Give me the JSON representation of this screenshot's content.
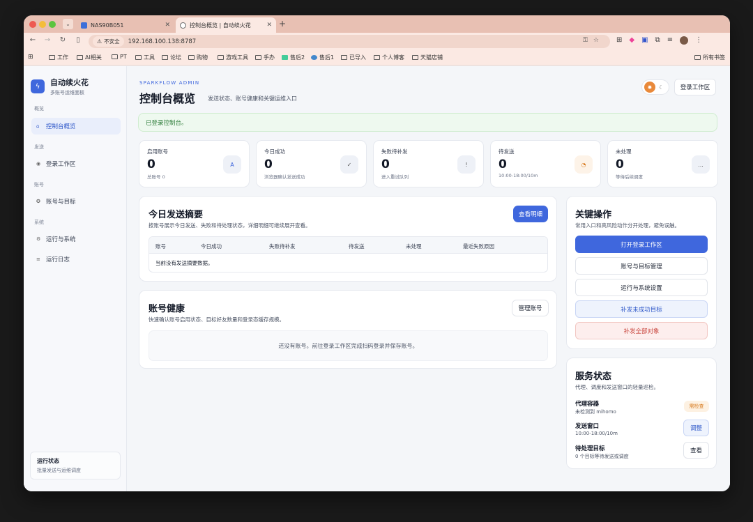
{
  "browser": {
    "tabs": [
      {
        "title": "NAS90B051"
      },
      {
        "title": "控制台概览 | 自动续火花"
      }
    ],
    "address": {
      "security_label": "不安全",
      "url": "192.168.100.138:8787"
    },
    "bookmarks": [
      "工作",
      "AI相关",
      "PT",
      "工具",
      "论坛",
      "购物",
      "游戏工具",
      "手办",
      "售后2",
      "售后1",
      "已导入",
      "个人博客",
      "天猫店铺"
    ],
    "all_bookmarks": "所有书签"
  },
  "sidebar": {
    "brand": {
      "name": "自动续火花",
      "subtitle": "多账号运维面板",
      "icon": "lightning-icon"
    },
    "sections": {
      "overview": "概览",
      "send": "发送",
      "account": "账号",
      "system": "系统"
    },
    "items": [
      {
        "label": "控制台概览",
        "icon": "home-icon"
      },
      {
        "label": "登录工作区",
        "icon": "target-icon"
      },
      {
        "label": "账号与目标",
        "icon": "gear-icon"
      },
      {
        "label": "运行与系统",
        "icon": "settings-icon"
      },
      {
        "label": "运行日志",
        "icon": "list-icon"
      }
    ],
    "status_box": {
      "title": "运行状态",
      "subtitle": "批量发送与运维调度"
    }
  },
  "header": {
    "eyebrow": "SPARKFLOW ADMIN",
    "title": "控制台概览",
    "subtitle": "发送状态、账号健康和关键运维入口",
    "login_button": "登录工作区"
  },
  "alert": "已登录控制台。",
  "stats": [
    {
      "label": "启用账号",
      "value": "0",
      "note": "总账号 0",
      "icon": "A"
    },
    {
      "label": "今日成功",
      "value": "0",
      "note": "浏览器确认发送成功",
      "icon": "✓"
    },
    {
      "label": "失败待补发",
      "value": "0",
      "note": "进入重试队列",
      "icon": "!"
    },
    {
      "label": "待发送",
      "value": "0",
      "note": "10:00-18:00/10m",
      "icon": "◔"
    },
    {
      "label": "未处理",
      "value": "0",
      "note": "等待后续调度",
      "icon": "..."
    }
  ],
  "summary": {
    "title": "今日发送摘要",
    "desc": "按账号展示今日发送、失败和待处理状态，详细明细可继续展开查看。",
    "button": "查看明细",
    "columns": [
      "账号",
      "今日成功",
      "失败待补发",
      "待发送",
      "未处理",
      "最近失败原因"
    ],
    "empty": "当前没有发送摘要数据。"
  },
  "health": {
    "title": "账号健康",
    "desc": "快速确认账号启用状态、目标好友数量和登录态缓存规模。",
    "button": "管理账号",
    "empty": "还没有账号。前往登录工作区完成扫码登录并保存账号。"
  },
  "actions": {
    "title": "关键操作",
    "desc": "常用入口和高风险动作分开处理，避免误触。",
    "buttons": [
      "打开登录工作区",
      "账号与目标管理",
      "运行与系统设置",
      "补发未成功目标",
      "补发全部对象"
    ]
  },
  "service": {
    "title": "服务状态",
    "desc": "代理、调度和发送窗口的轻量巡检。",
    "rows": [
      {
        "name": "代理容器",
        "note": "未检测到 mihomo",
        "badge": "需检查"
      },
      {
        "name": "发送窗口",
        "note": "10:00-18:00/10m",
        "badge": "调整"
      },
      {
        "name": "待处理目标",
        "note": "0 个目标等待发送或调度",
        "badge": "查看"
      }
    ]
  },
  "colors": {
    "accent": "#3f67dd",
    "success": "#2e7d3a",
    "warning": "#d77a1f",
    "danger": "#c9473f"
  }
}
